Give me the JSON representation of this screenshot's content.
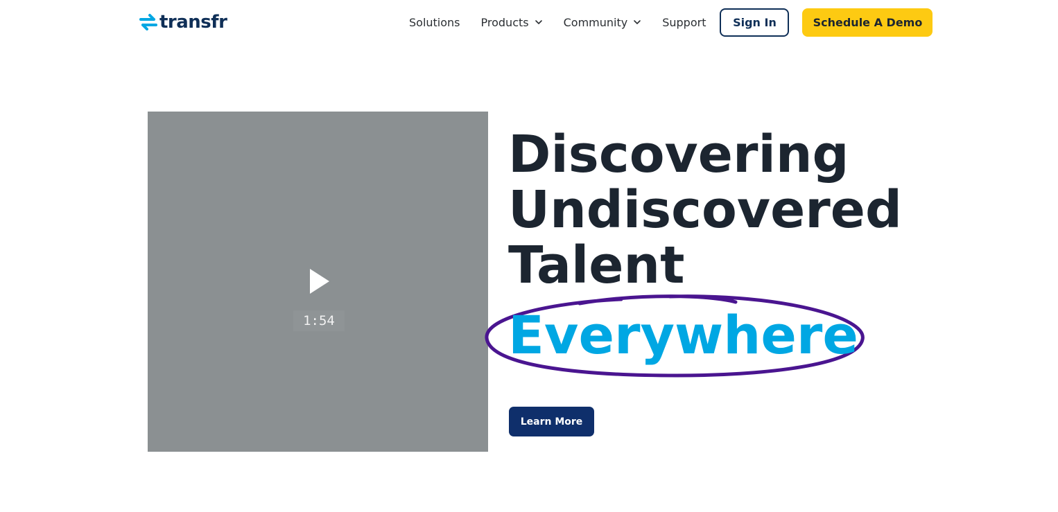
{
  "header": {
    "logo_text": "transfr",
    "logo_icon": "transfer-arrows-icon",
    "nav": {
      "solutions": "Solutions",
      "products": "Products",
      "community": "Community",
      "support": "Support"
    },
    "sign_in": "Sign In",
    "schedule_demo": "Schedule A Demo"
  },
  "hero": {
    "video": {
      "duration": "1:54",
      "play_icon": "play-icon"
    },
    "headline_lines": [
      "Discovering",
      "Undiscovered",
      "Talent"
    ],
    "highlight_word": "Everywhere",
    "cta": "Learn More"
  },
  "colors": {
    "brand_navy": "#0f2f57",
    "accent_blue": "#00a7e3",
    "demo_yellow": "#fdca12",
    "circle_purple": "#4a1590",
    "video_gray": "#8b9092",
    "cta_navy": "#0f2f6b"
  }
}
